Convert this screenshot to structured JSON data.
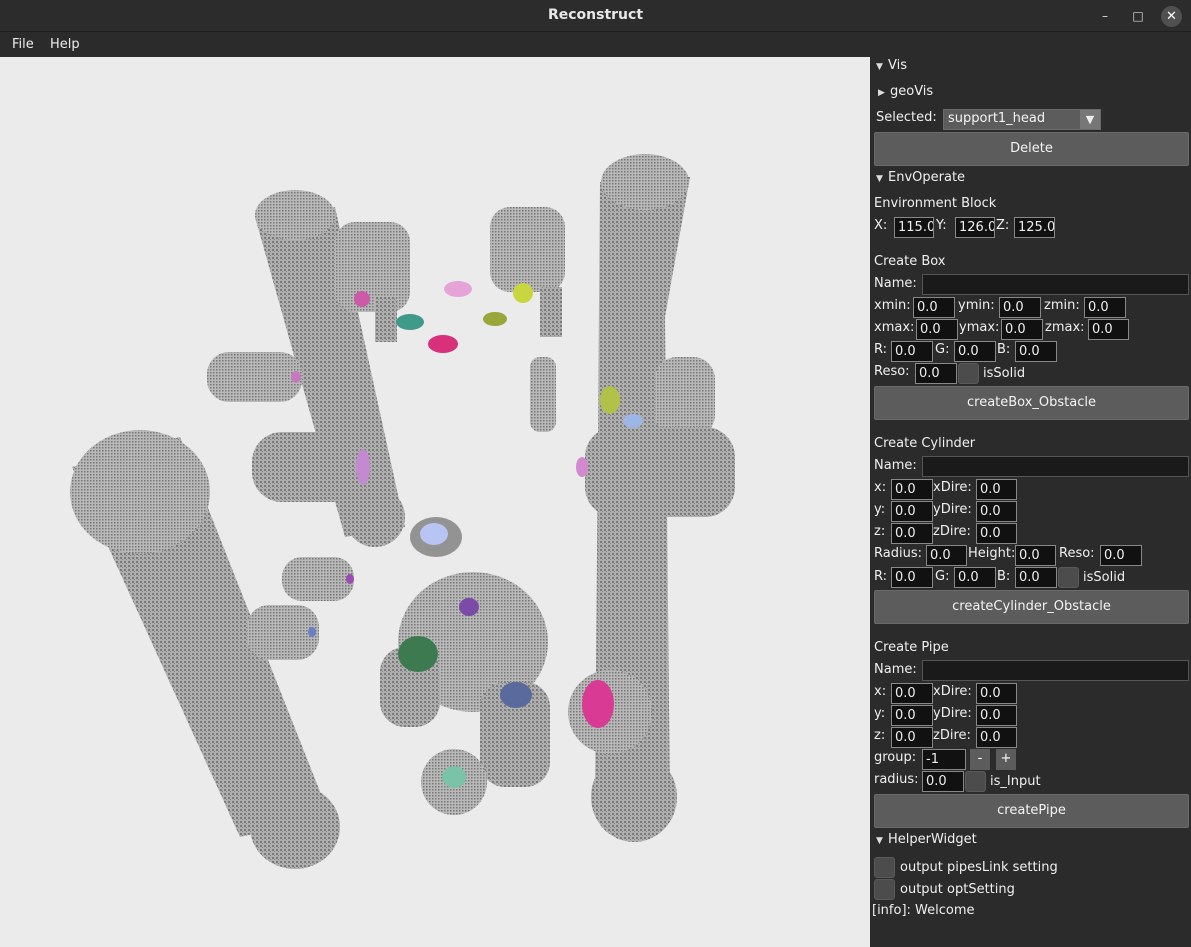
{
  "window": {
    "title": "Reconstruct",
    "minimize_glyph": "–",
    "maximize_glyph": "□",
    "close_glyph": "✕"
  },
  "menu": {
    "file": "File",
    "help": "Help"
  },
  "vis": {
    "header": "Vis",
    "geovis": "geoVis",
    "selected_label": "Selected:",
    "selected_value": "support1_head",
    "delete": "Delete"
  },
  "env": {
    "header": "EnvOperate",
    "block_title": "Environment Block",
    "x_label": "X:",
    "x": "115.0",
    "y_label": "Y:",
    "y": "126.0",
    "z_label": "Z:",
    "z": "125.0"
  },
  "box": {
    "title": "Create Box",
    "name_label": "Name:",
    "name": "",
    "xmin_label": "xmin:",
    "xmin": "0.0",
    "ymin_label": "ymin:",
    "ymin": "0.0",
    "zmin_label": "zmin:",
    "zmin": "0.0",
    "xmax_label": "xmax:",
    "xmax": "0.0",
    "ymax_label": "ymax:",
    "ymax": "0.0",
    "zmax_label": "zmax:",
    "zmax": "0.0",
    "r_label": "R:",
    "r": "0.0",
    "g_label": "G:",
    "g": "0.0",
    "b_label": "B:",
    "b": "0.0",
    "reso_label": "Reso:",
    "reso": "0.0",
    "solid_label": "isSolid",
    "button": "createBox_Obstacle"
  },
  "cyl": {
    "title": "Create Cylinder",
    "name_label": "Name:",
    "name": "",
    "x_label": "x:",
    "x": "0.0",
    "xdir_label": "xDire:",
    "xdir": "0.0",
    "y_label": "y:",
    "y": "0.0",
    "ydir_label": "yDire:",
    "ydir": "0.0",
    "z_label": "z:",
    "z": "0.0",
    "zdir_label": "zDire:",
    "zdir": "0.0",
    "radius_label": "Radius:",
    "radius": "0.0",
    "height_label": "Height:",
    "height": "0.0",
    "reso_label": "Reso:",
    "reso": "0.0",
    "r_label": "R:",
    "r": "0.0",
    "g_label": "G:",
    "g": "0.0",
    "b_label": "B:",
    "b": "0.0",
    "solid_label": "isSolid",
    "button": "createCylinder_Obstacle"
  },
  "pipe": {
    "title": "Create Pipe",
    "name_label": "Name:",
    "name": "",
    "x_label": "x:",
    "x": "0.0",
    "xdir_label": "xDire:",
    "xdir": "0.0",
    "y_label": "y:",
    "y": "0.0",
    "ydir_label": "yDire:",
    "ydir": "0.0",
    "z_label": "z:",
    "z": "0.0",
    "zdir_label": "zDire:",
    "zdir": "0.0",
    "group_label": "group:",
    "group": "-1",
    "minus": "-",
    "plus": "+",
    "radius_label": "radius:",
    "radius": "0.0",
    "input_label": "is_Input",
    "button": "createPipe"
  },
  "helper": {
    "header": "HelperWidget",
    "opt1": "output pipesLink setting",
    "opt2": "output optSetting",
    "info": "[info]: Welcome"
  }
}
